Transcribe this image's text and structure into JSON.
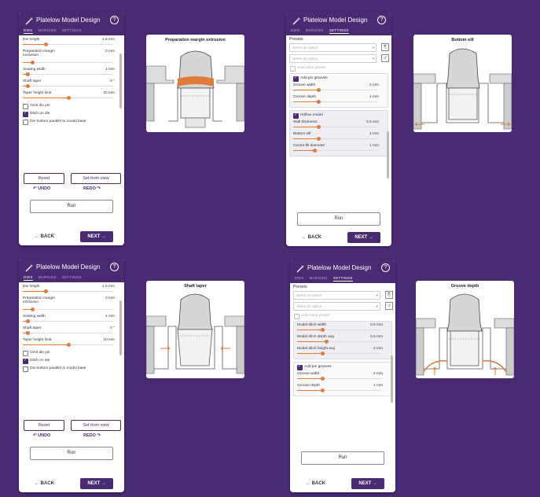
{
  "app_title": "Platelow Model Design",
  "tabs": {
    "die": "DIES",
    "margins": "MARGINS",
    "settings": "SETTINGS"
  },
  "die_panel": {
    "sliders": [
      {
        "label": "Die height",
        "value": "1.5 mm",
        "pct": 0.25
      },
      {
        "label": "Preparation margin exclusion",
        "value": "0 mm",
        "pct": 0.1
      },
      {
        "label": "Seating width",
        "value": "1 mm",
        "pct": 0.05
      },
      {
        "label": "Shaft taper",
        "value": "0 °",
        "pct": 0.05
      },
      {
        "label": "Taper height limit",
        "value": "10 mm",
        "pct": 0.5
      }
    ],
    "checks": [
      {
        "label": "Omit die pin",
        "on": false
      },
      {
        "label": "Ditch on die",
        "on": true
      },
      {
        "label": "Die bottom parallel to model base",
        "on": false
      }
    ],
    "reset": "Reset",
    "from_view": "Set from view",
    "undo": "UNDO",
    "redo": "REDO",
    "run": "Run",
    "back": "BACK",
    "next": "NEXT"
  },
  "settings_panel_a": {
    "presets_label": "Presets",
    "select_placeholder": "Select an option",
    "select2_placeholder": "Select an option",
    "auto_label": "Auto save preset",
    "pin_grooves": "Add pin grooves",
    "groove_width": {
      "label": "Groove width",
      "value": "2 mm",
      "pct": 0.3
    },
    "groove_depth": {
      "label": "Groove depth",
      "value": "1 mm",
      "pct": 0.3
    },
    "hollow": "Hollow model",
    "wall": {
      "label": "Wall thickness",
      "value": "2.5 mm",
      "pct": 0.3
    },
    "bottom": {
      "label": "Bottom sill",
      "value": "1 mm",
      "pct": 0.3
    },
    "centre": {
      "label": "Centre fill diameter",
      "value": "1 mm",
      "pct": 0.25
    },
    "run": "Run",
    "back": "BACK",
    "next": "NEXT"
  },
  "settings_panel_b": {
    "presets_label": "Presets",
    "select_placeholder": "Select an option",
    "select2_placeholder": "Select an option",
    "auto_label": "Auto save preset",
    "ditch_width": {
      "label": "Model ditch width",
      "value": "0.5 mm",
      "pct": 0.3
    },
    "ditch_depth": {
      "label": "Model ditch depth avg",
      "value": "0.5 mm",
      "pct": 0.35
    },
    "ditch_height": {
      "label": "Model ditch height avg",
      "value": "2 mm",
      "pct": 0.3
    },
    "pin_grooves": "Add pin grooves",
    "groove_width": {
      "label": "Groove width",
      "value": "2 mm",
      "pct": 0.3
    },
    "groove_depth": {
      "label": "Groove depth",
      "value": "1 mm",
      "pct": 0.3
    },
    "run": "Run",
    "back": "BACK",
    "next": "NEXT"
  },
  "diagrams": {
    "d1": "Preparation margin extrusion",
    "d2": "Bottom sill",
    "d3": "Shaft taper",
    "d4": "Groove depth"
  },
  "colors": {
    "brand": "#4a2a73",
    "accent": "#e07b39"
  }
}
